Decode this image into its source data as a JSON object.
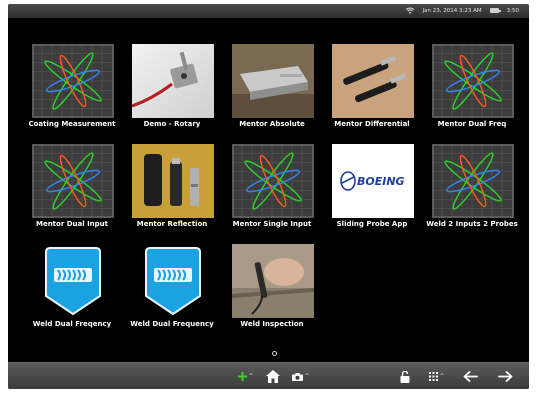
{
  "status": {
    "datetime": "Jan 23, 2014 3:23 AM",
    "battery_level": "3:50"
  },
  "apps": [
    {
      "label": "Coating Measurement",
      "thumb": "lissajous"
    },
    {
      "label": "Demo - Rotary",
      "thumb": "rotary-probe-photo"
    },
    {
      "label": "Mentor Absolute",
      "thumb": "absolute-probe-photo"
    },
    {
      "label": "Mentor Differential",
      "thumb": "differential-probe-photo"
    },
    {
      "label": "Mentor Dual Freq",
      "thumb": "lissajous"
    },
    {
      "label": "Mentor Dual Input",
      "thumb": "lissajous"
    },
    {
      "label": "Mentor Reflection",
      "thumb": "reflection-probe-photo"
    },
    {
      "label": "Mentor Single Input",
      "thumb": "lissajous"
    },
    {
      "label": "Sliding Probe App",
      "thumb": "boeing-logo",
      "logo_text": "BOEING"
    },
    {
      "label": "Weld 2 Inputs 2 Probes",
      "thumb": "lissajous"
    },
    {
      "label": "Weld Dual Freqency",
      "thumb": "weld-badge"
    },
    {
      "label": "Weld Dual Frequency",
      "thumb": "weld-badge"
    },
    {
      "label": "Weld Inspection",
      "thumb": "weld-inspection-photo"
    }
  ],
  "taskbar": {
    "caret": "^",
    "icons": [
      "add-icon",
      "home-icon",
      "camera-icon",
      "lock-icon",
      "apps-grid-icon",
      "back-arrow-icon",
      "forward-arrow-icon"
    ],
    "add_color": "#38d22b"
  }
}
